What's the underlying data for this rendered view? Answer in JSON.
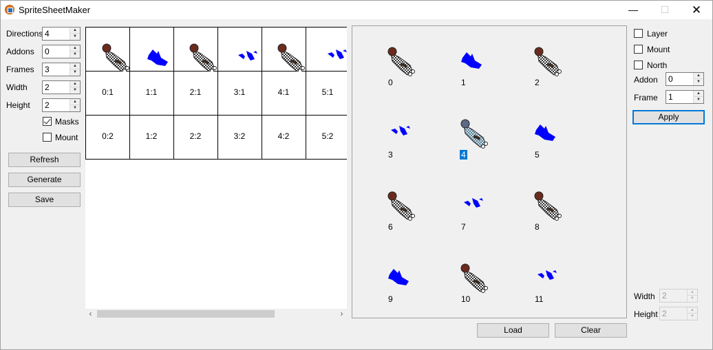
{
  "window": {
    "title": "SpriteSheetMaker",
    "min_glyph": "—",
    "max_glyph": "☐",
    "close_glyph": "✕"
  },
  "settings": {
    "directions": {
      "label": "Directions",
      "value": "4"
    },
    "addons": {
      "label": "Addons",
      "value": "0"
    },
    "frames": {
      "label": "Frames",
      "value": "3"
    },
    "width": {
      "label": "Width",
      "value": "2"
    },
    "height": {
      "label": "Height",
      "value": "2"
    },
    "masks": {
      "label": "Masks",
      "checked": true
    },
    "mount": {
      "label": "Mount",
      "checked": false
    }
  },
  "actions": {
    "refresh": "Refresh",
    "generate": "Generate",
    "save": "Save"
  },
  "sheet_grid": {
    "rows": [
      [
        "",
        "",
        "",
        "",
        "",
        ""
      ],
      [
        "0:1",
        "1:1",
        "2:1",
        "3:1",
        "4:1",
        "5:1"
      ],
      [
        "0:2",
        "1:2",
        "2:2",
        "3:2",
        "4:2",
        "5:2"
      ]
    ],
    "sprites_row0": [
      "char",
      "mask",
      "char",
      "mask-small",
      "char",
      "mask-small"
    ]
  },
  "preview": {
    "tiles": [
      {
        "num": "0",
        "kind": "char"
      },
      {
        "num": "1",
        "kind": "mask"
      },
      {
        "num": "2",
        "kind": "char"
      },
      {
        "num": "3",
        "kind": "mask-small"
      },
      {
        "num": "4",
        "kind": "char-selected",
        "selected": true
      },
      {
        "num": "5",
        "kind": "mask"
      },
      {
        "num": "6",
        "kind": "char"
      },
      {
        "num": "7",
        "kind": "mask-small"
      },
      {
        "num": "8",
        "kind": "char"
      },
      {
        "num": "9",
        "kind": "mask"
      },
      {
        "num": "10",
        "kind": "char"
      },
      {
        "num": "11",
        "kind": "mask-small"
      }
    ],
    "load": "Load",
    "clear": "Clear"
  },
  "layer_panel": {
    "layer": {
      "label": "Layer",
      "checked": false
    },
    "mount": {
      "label": "Mount",
      "checked": false
    },
    "north": {
      "label": "North",
      "checked": false
    },
    "addon": {
      "label": "Addon",
      "value": "0"
    },
    "frame": {
      "label": "Frame",
      "value": "1"
    },
    "apply": "Apply",
    "width": {
      "label": "Width",
      "value": "2"
    },
    "height": {
      "label": "Height",
      "value": "2"
    }
  },
  "colors": {
    "accent": "#0078d7",
    "mask": "#0000ff"
  }
}
